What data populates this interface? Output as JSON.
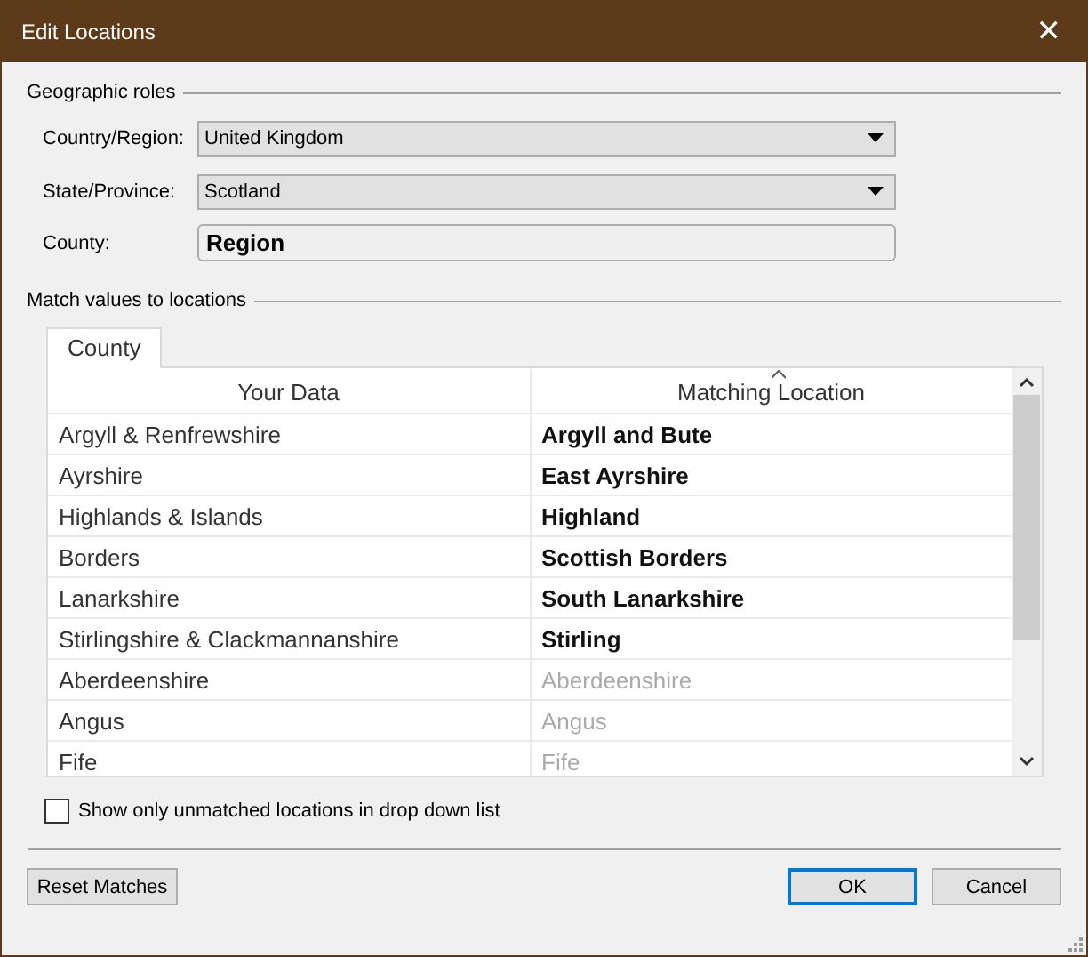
{
  "window": {
    "title": "Edit Locations",
    "close": "✕"
  },
  "geographic_roles": {
    "heading": "Geographic roles",
    "fields": [
      {
        "kind": "dropdown",
        "label": "Country/Region:",
        "value": "United Kingdom"
      },
      {
        "kind": "dropdown",
        "label": "State/Province:",
        "value": "Scotland"
      },
      {
        "kind": "readonly",
        "label": "County:",
        "value": "Region"
      }
    ]
  },
  "match": {
    "heading": "Match values to locations",
    "tabs": [
      {
        "label": "County",
        "selected": true
      }
    ],
    "table": {
      "columns": [
        "Your Data",
        "Matching Location"
      ],
      "rows": [
        {
          "your_data": "Argyll & Renfrewshire",
          "matching_location": "Argyll and Bute",
          "matched": true
        },
        {
          "your_data": "Ayrshire",
          "matching_location": "East Ayrshire",
          "matched": true
        },
        {
          "your_data": "Highlands & Islands",
          "matching_location": "Highland",
          "matched": true
        },
        {
          "your_data": "Borders",
          "matching_location": "Scottish Borders",
          "matched": true
        },
        {
          "your_data": "Lanarkshire",
          "matching_location": "South Lanarkshire",
          "matched": true
        },
        {
          "your_data": "Stirlingshire & Clackmannanshire",
          "matching_location": "Stirling",
          "matched": true
        },
        {
          "your_data": "Aberdeenshire",
          "matching_location": "Aberdeenshire",
          "matched": false
        },
        {
          "your_data": "Angus",
          "matching_location": "Angus",
          "matched": false
        },
        {
          "your_data": "Fife",
          "matching_location": "Fife",
          "matched": false
        }
      ]
    }
  },
  "unmatched_only": {
    "label": "Show only unmatched locations in drop down list",
    "checked": false
  },
  "buttons": [
    {
      "label": "Reset Matches",
      "kind": "secondary",
      "default": false
    },
    {
      "label": "OK",
      "kind": "primary",
      "default": true
    },
    {
      "label": "Cancel",
      "kind": "primary",
      "default": false
    }
  ]
}
